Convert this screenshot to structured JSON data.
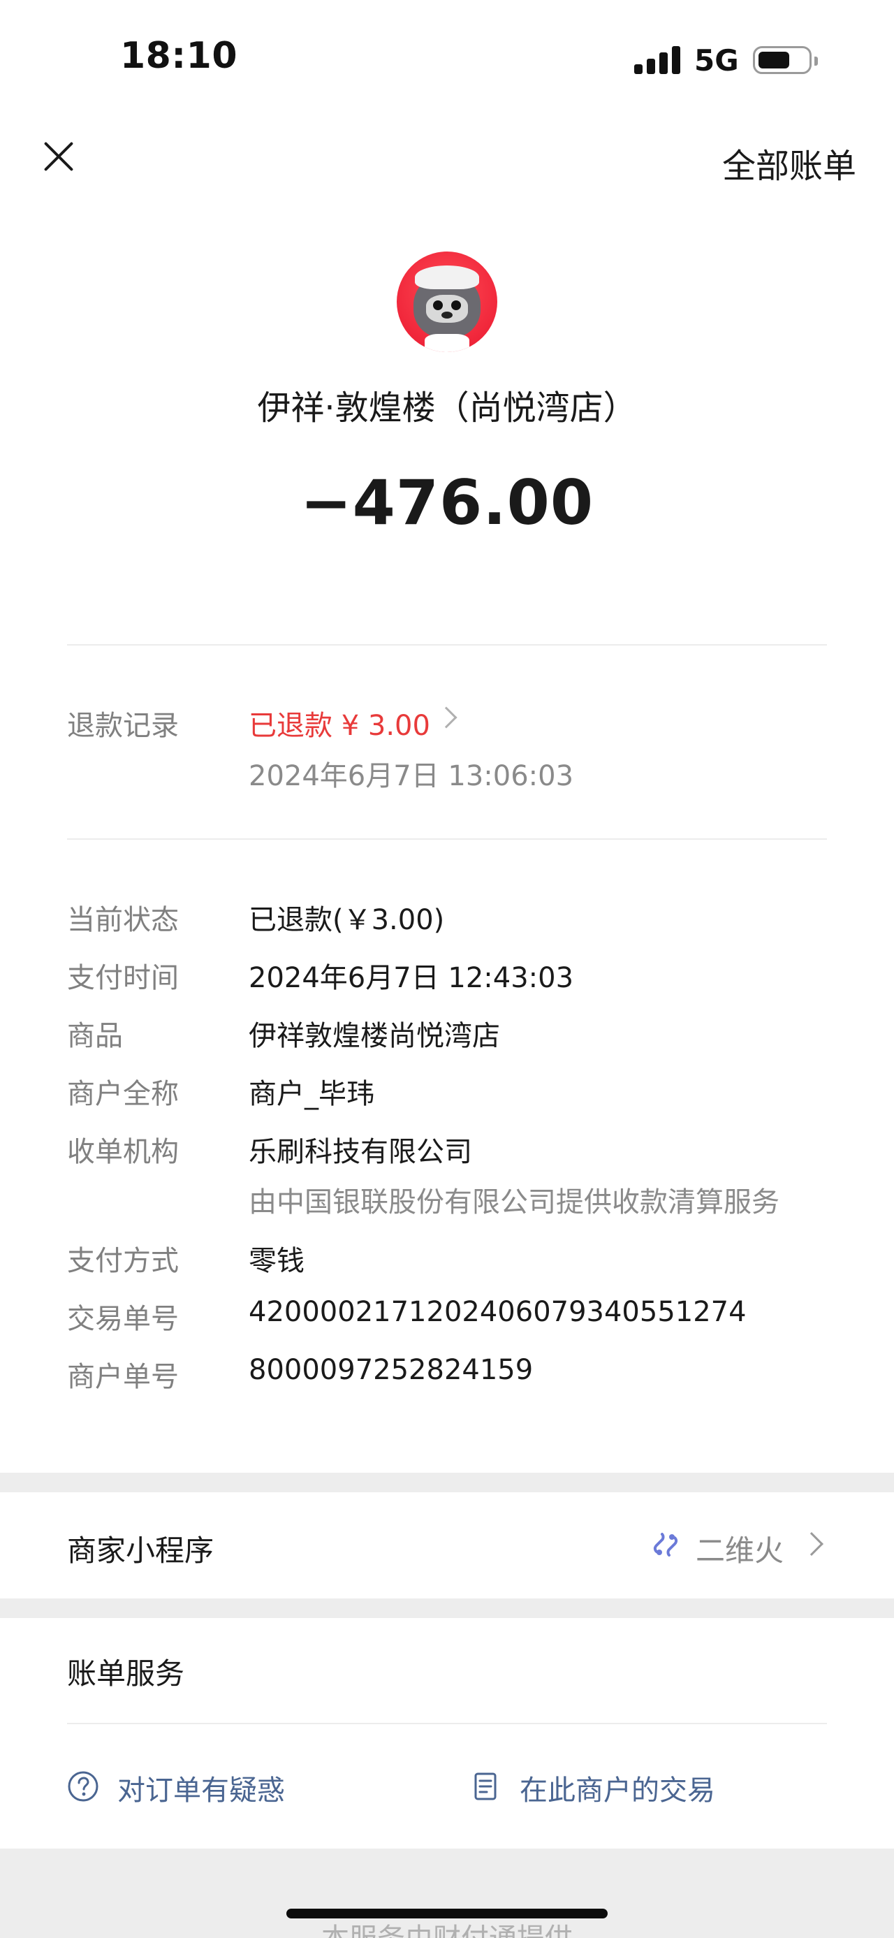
{
  "status_bar": {
    "time": "18:10",
    "network": "5G"
  },
  "header": {
    "right_label": "全部账单"
  },
  "merchant": {
    "name": "伊祥·敦煌楼（尚悦湾店）",
    "amount": "−476.00"
  },
  "refund": {
    "label": "退款记录",
    "status": "已退款 ¥ 3.00",
    "time": "2024年6月7日 13:06:03"
  },
  "details": [
    {
      "label": "当前状态",
      "value": "已退款(￥3.00)"
    },
    {
      "label": "支付时间",
      "value": "2024年6月7日 12:43:03"
    },
    {
      "label": "商品",
      "value": "伊祥敦煌楼尚悦湾店"
    },
    {
      "label": "商户全称",
      "value": "商户_毕玮"
    },
    {
      "label": "收单机构",
      "value": "乐刷科技有限公司",
      "sub": "由中国银联股份有限公司提供收款清算服务"
    },
    {
      "label": "支付方式",
      "value": "零钱"
    },
    {
      "label": "交易单号",
      "value": "4200002171202406079340551274"
    },
    {
      "label": "商户单号",
      "value": "8000097252824159"
    }
  ],
  "mini_program": {
    "label": "商家小程序",
    "link_text": "二维火"
  },
  "bill_service": {
    "title": "账单服务",
    "question_label": "对订单有疑惑",
    "merchant_tx_label": "在此商户的交易"
  },
  "footer": {
    "text": "本服务由财付通提供"
  },
  "colors": {
    "refund_red": "#e83a3a",
    "link_blue": "#4a6591",
    "mini_icon": "#6b7ad8"
  }
}
